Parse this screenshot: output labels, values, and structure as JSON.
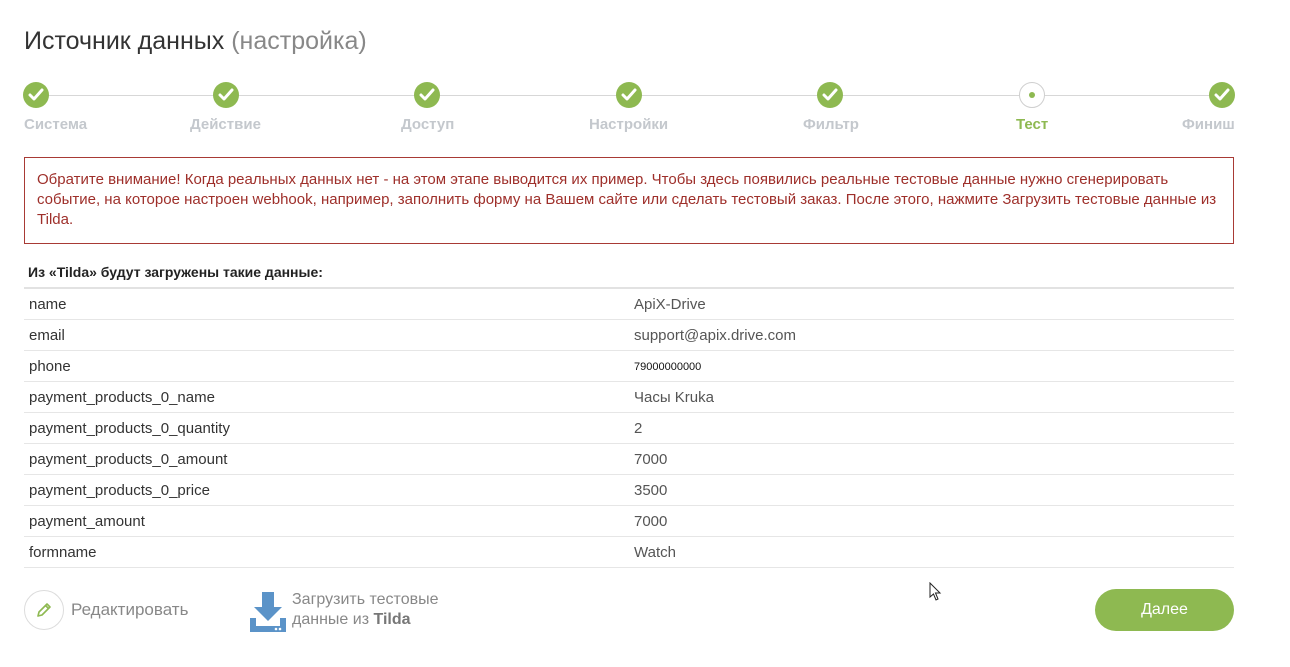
{
  "header": {
    "title": "Источник данных",
    "subtitle": "(настройка)"
  },
  "steps": [
    {
      "label": "Система",
      "state": "done"
    },
    {
      "label": "Действие",
      "state": "done"
    },
    {
      "label": "Доступ",
      "state": "done"
    },
    {
      "label": "Настройки",
      "state": "done"
    },
    {
      "label": "Фильтр",
      "state": "done"
    },
    {
      "label": "Тест",
      "state": "current"
    },
    {
      "label": "Финиш",
      "state": "done"
    }
  ],
  "notice": "Обратите внимание! Когда реальных данных нет - на этом этапе выводится их пример. Чтобы здесь появились реальные тестовые данные нужно сгенерировать событие, на которое настроен webhook, например, заполнить форму на Вашем сайте или сделать тестовый заказ. После этого, нажмите Загрузить тестовые данные из Tilda.",
  "data_section": {
    "heading": "Из «Tilda» будут загружены такие данные:",
    "rows": [
      {
        "key": "name",
        "value": "ApiX-Drive"
      },
      {
        "key": "email",
        "value": "support@apix.drive.com"
      },
      {
        "key": "phone",
        "value": "79000000000"
      },
      {
        "key": "payment_products_0_name",
        "value": "Часы Kruka"
      },
      {
        "key": "payment_products_0_quantity",
        "value": "2"
      },
      {
        "key": "payment_products_0_amount",
        "value": "7000"
      },
      {
        "key": "payment_products_0_price",
        "value": "3500"
      },
      {
        "key": "payment_amount",
        "value": "7000"
      },
      {
        "key": "formname",
        "value": "Watch"
      }
    ]
  },
  "actions": {
    "edit_label": "Редактировать",
    "load_label_line1": "Загрузить тестовые",
    "load_label_line2_prefix": "данные из",
    "load_label_line2_bold": "Tilda",
    "next_label": "Далее"
  },
  "colors": {
    "accent": "#8eb951",
    "notice_border": "#a83a35",
    "notice_text": "#9e2f2a"
  },
  "icons": {
    "step_done": "check-icon",
    "edit": "pencil-icon",
    "load": "download-icon",
    "cursor": "mouse-cursor-icon"
  }
}
